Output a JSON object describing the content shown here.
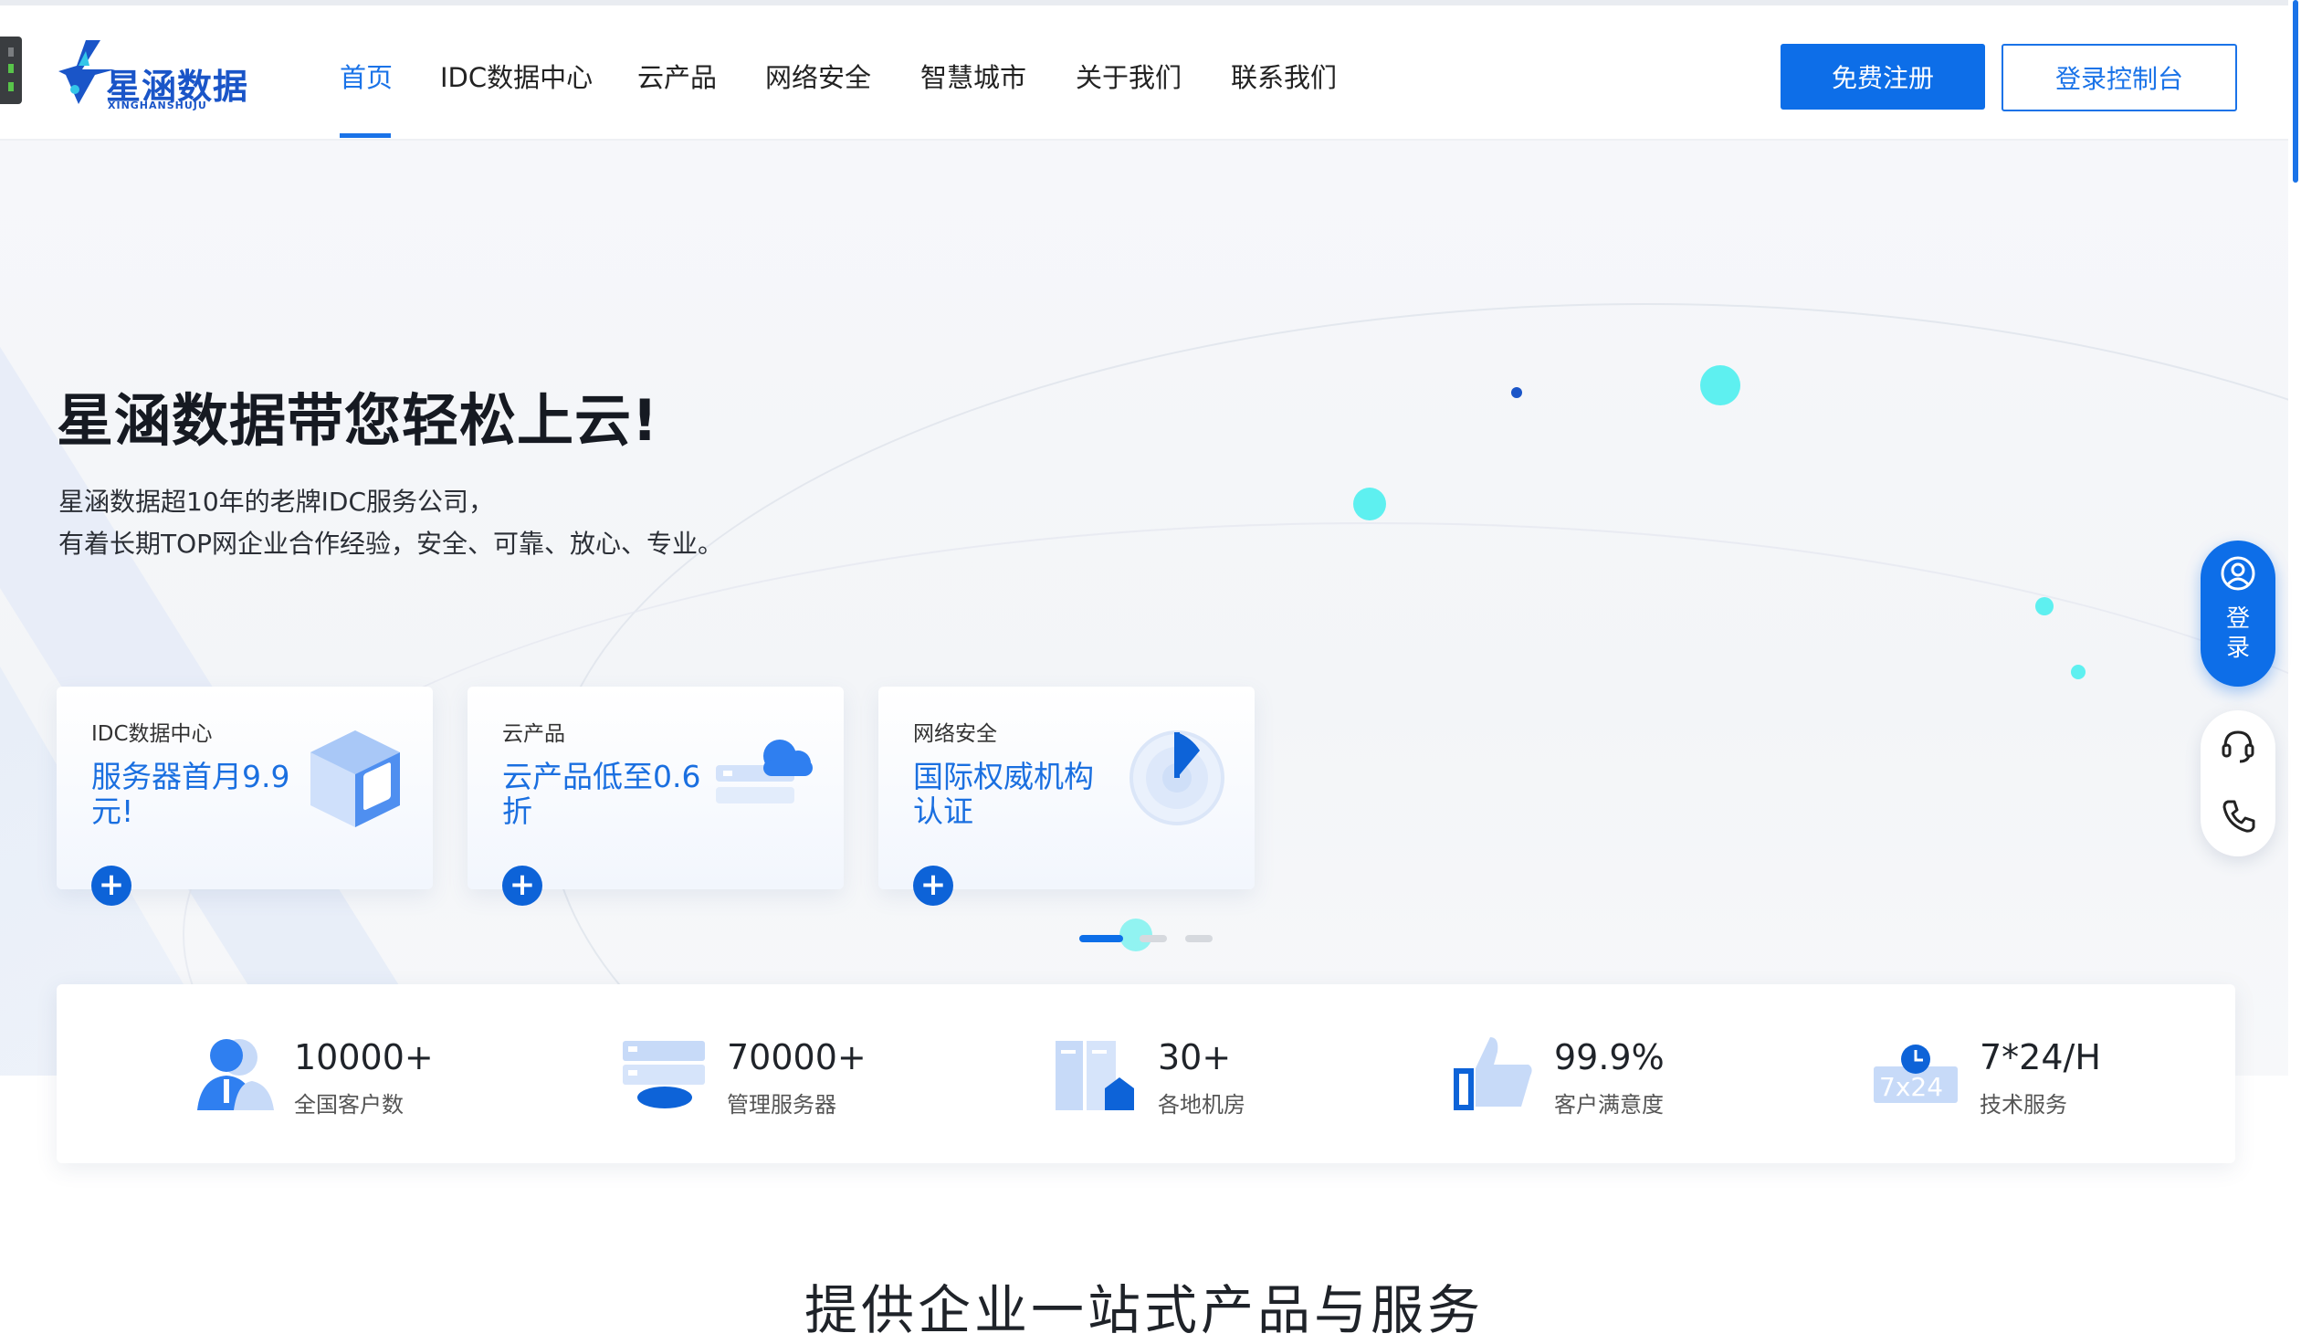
{
  "header": {
    "logo_name": "星涵数据",
    "logo_sub": "XINGHANSHUJU",
    "nav": [
      {
        "label": "首页",
        "active": true
      },
      {
        "label": "IDC数据中心"
      },
      {
        "label": "云产品"
      },
      {
        "label": "网络安全"
      },
      {
        "label": "智慧城市"
      },
      {
        "label": "关于我们"
      },
      {
        "label": "联系我们"
      }
    ],
    "register_button": "免费注册",
    "console_button": "登录控制台"
  },
  "hero": {
    "title": "星涵数据带您轻松上云!",
    "desc_line1": "星涵数据超10年的老牌IDC服务公司，",
    "desc_line2": "有着长期TOP网企业合作经验，安全、可靠、放心、专业。"
  },
  "cards": [
    {
      "category": "IDC数据中心",
      "promo": "服务器首月9.9元!",
      "icon": "server-cube-icon"
    },
    {
      "category": "云产品",
      "promo": "云产品低至0.6折",
      "icon": "cloud-server-icon"
    },
    {
      "category": "网络安全",
      "promo": "国际权威机构认证",
      "icon": "security-shield-icon"
    }
  ],
  "carousel": {
    "pages": 3,
    "active": 1
  },
  "stats": [
    {
      "value": "10000+",
      "label": "全国客户数",
      "icon": "customer-icon"
    },
    {
      "value": "70000+",
      "label": "管理服务器",
      "icon": "server-rack-icon"
    },
    {
      "value": "30+",
      "label": "各地机房",
      "icon": "datacenter-building-icon"
    },
    {
      "value": "99.9%",
      "label": "客户满意度",
      "icon": "thumbs-up-icon"
    },
    {
      "value": "7*24/H",
      "label": "技术服务",
      "icon": "clock-24h-icon"
    }
  ],
  "stat_badge": "7x24",
  "section": {
    "title": "提供企业一站式产品与服务"
  },
  "float_bar": {
    "login_label": "登录",
    "tools": [
      "headset-icon",
      "phone-icon"
    ]
  },
  "colors": {
    "primary": "#0d6ee8",
    "accent_cyan": "#5ef0f0",
    "text": "#1f2329"
  }
}
